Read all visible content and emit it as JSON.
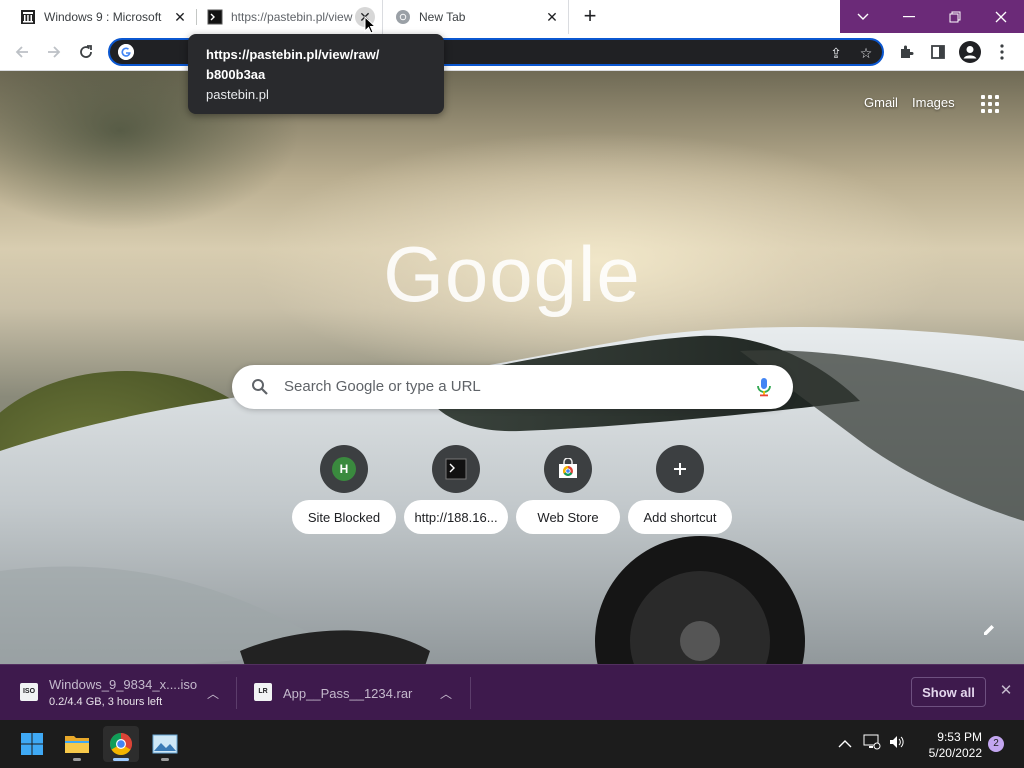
{
  "browser": {
    "tabs": [
      {
        "title": "Windows 9 : Microsoft",
        "favicon": "archive-org-icon",
        "active": false
      },
      {
        "title": "https://pastebin.pl/view",
        "favicon": "terminal-icon",
        "active": false
      },
      {
        "title": "New Tab",
        "favicon": "chrome-icon",
        "active": true
      }
    ],
    "accent_color": "#6b2a78"
  },
  "tooltip": {
    "line1": "https://pastebin.pl/view/raw/",
    "line2": "b800b3aa",
    "line3": "pastebin.pl"
  },
  "ntp": {
    "links": {
      "gmail": "Gmail",
      "images": "Images"
    },
    "logo": "Google",
    "search_placeholder": "Search Google or type a URL",
    "shortcuts": [
      {
        "label": "Site Blocked",
        "icon": "letter-h-icon",
        "letter": "H"
      },
      {
        "label": "http://188.16...",
        "icon": "terminal-icon"
      },
      {
        "label": "Web Store",
        "icon": "web-store-icon"
      },
      {
        "label": "Add shortcut",
        "icon": "plus-icon"
      }
    ]
  },
  "downloads": {
    "items": [
      {
        "name": "Windows_9_9834_x....iso",
        "status": "0.2/4.4 GB, 3 hours left",
        "icon": "iso-file-icon",
        "icon_text": "ISO"
      },
      {
        "name": "App__Pass__1234.rar",
        "status": "",
        "icon": "rar-file-icon",
        "icon_text": "LR"
      }
    ],
    "show_all": "Show all"
  },
  "taskbar": {
    "time": "9:53 PM",
    "date": "5/20/2022",
    "notifications": "2"
  }
}
